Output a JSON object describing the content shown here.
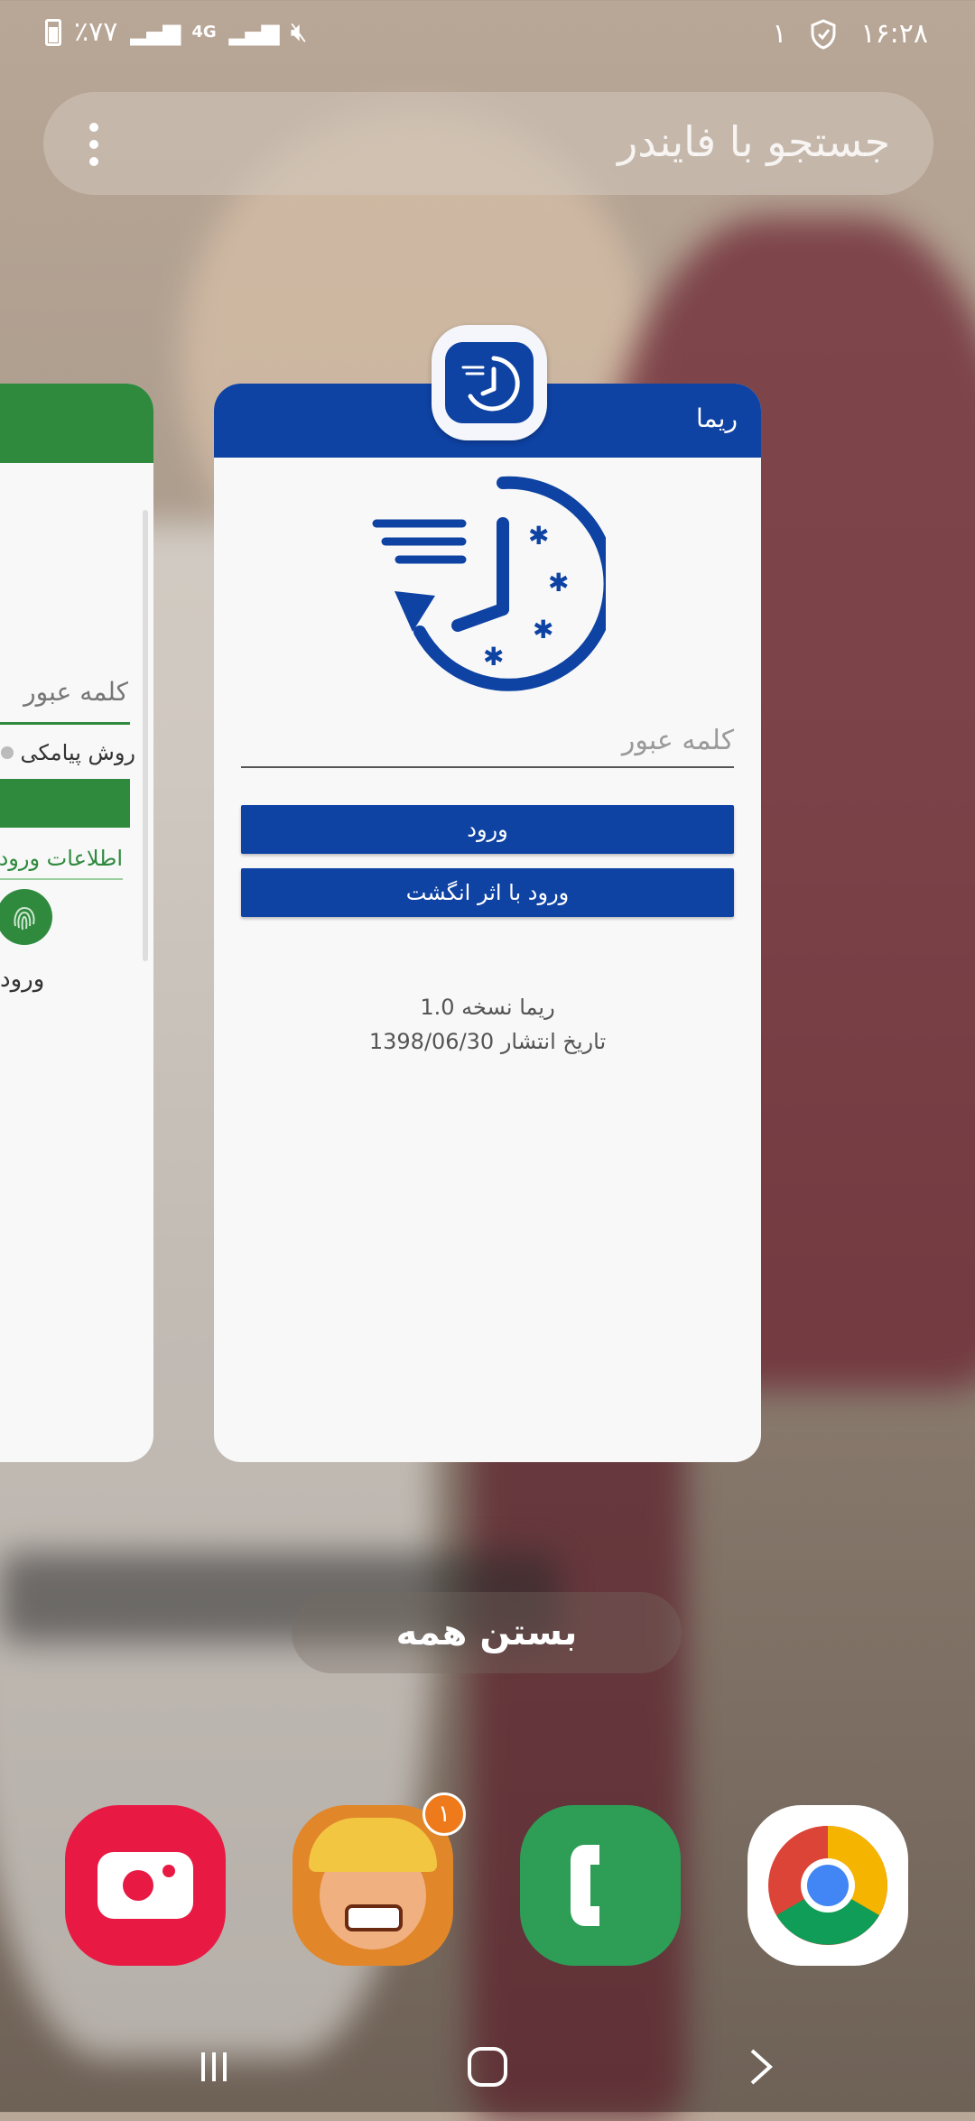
{
  "status_bar": {
    "time": "۱۶:۲۸",
    "notification_count": "۱",
    "battery": "٪۷۷",
    "network": "4G"
  },
  "search": {
    "placeholder": "جستجو با فایندر"
  },
  "left_card": {
    "password_placeholder": "کلمه عبور",
    "sms_label": "روش پیامکی",
    "info_link": "اطلاعات ورود",
    "fingerprint_label": "ورود",
    "accent": "#2f8a3e"
  },
  "main_card": {
    "app_name": "ریما",
    "password_placeholder": "کلمه عبور",
    "login_button": "ورود",
    "fingerprint_button": "ورود با اثر انگشت",
    "version_line": "ریما نسخه 1.0",
    "release_line": "تاریخ انتشار 1398/06/30",
    "accent": "#0e42a3"
  },
  "close_all": "بستن همه",
  "dock": {
    "apps": [
      {
        "name": "video-call-app",
        "icon": "camera-icon"
      },
      {
        "name": "clash-of-clans",
        "icon": "game-icon",
        "badge": "۱"
      },
      {
        "name": "phone",
        "icon": "phone-icon"
      },
      {
        "name": "chrome",
        "icon": "chrome-icon"
      }
    ]
  },
  "nav": {
    "buttons": [
      "recents-icon",
      "home-icon",
      "back-icon"
    ]
  }
}
